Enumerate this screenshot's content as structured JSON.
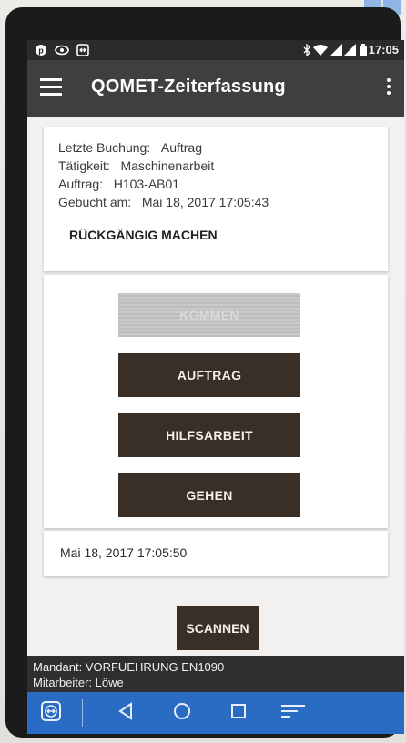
{
  "status_bar": {
    "left_icons": [
      "pinterest-icon",
      "eye-icon",
      "teamviewer-icon"
    ],
    "right_icons": [
      "bluetooth-icon",
      "wifi-icon",
      "signal-icon",
      "signal-icon",
      "battery-icon"
    ],
    "time": "17:05"
  },
  "toolbar": {
    "title": "QOMET-Zeiterfassung",
    "menu_icon": "hamburger-icon",
    "overflow_icon": "more-vert-icon"
  },
  "last_booking": {
    "label_booking": "Letzte Buchung:",
    "value_booking": "Auftrag",
    "label_activity": "Tätigkeit:",
    "value_activity": "Maschinenarbeit",
    "label_order": "Auftrag:",
    "value_order": "H103-AB01",
    "label_booked_at": "Gebucht am:",
    "value_booked_at": "Mai 18, 2017 17:05:43",
    "undo_label": "RÜCKGÄNGIG MACHEN"
  },
  "actions": {
    "kommen": "KOMMEN",
    "auftrag": "AUFTRAG",
    "hilfsarbeit": "HILFSARBEIT",
    "gehen": "GEHEN"
  },
  "current_time": "Mai 18, 2017 17:05:50",
  "scan_label": "SCANNEN",
  "footer": {
    "mandant": "Mandant: VORFUEHRUNG EN1090",
    "mitarbeiter": "Mitarbeiter: Löwe"
  },
  "colors": {
    "toolbar": "#3f3f3f",
    "button": "#3a2f26",
    "navbar": "#2a6cc4",
    "content_bg": "#f2f1ef"
  }
}
